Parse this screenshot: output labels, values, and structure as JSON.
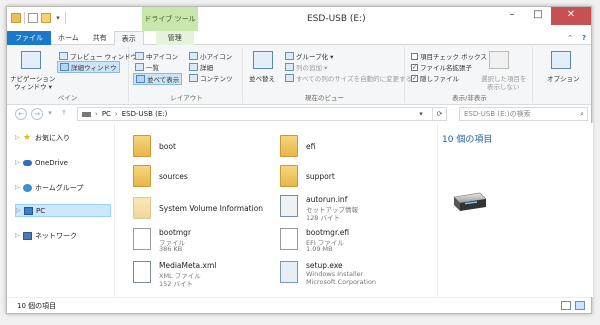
{
  "window": {
    "title": "ESD-USB (E:)",
    "context_tab_title": "ドライブ ツール",
    "controls": {
      "minimize": "–",
      "maximize": "□",
      "close": "✕"
    }
  },
  "quick_access": {
    "dropdown": "▾"
  },
  "tabs": [
    {
      "label": "ファイル"
    },
    {
      "label": "ホーム"
    },
    {
      "label": "共有"
    },
    {
      "label": "表示"
    },
    {
      "label": "管理"
    }
  ],
  "ribbon_controls": {
    "collapse": "⌃",
    "help": "?"
  },
  "ribbon": {
    "pane": {
      "nav_pane_line1": "ナビゲーション",
      "nav_pane_line2": "ウィンドウ ▾",
      "preview_pane": "プレビュー ウィンドウ",
      "details_pane": "詳細ウィンドウ",
      "group_label": "ペイン"
    },
    "layout": {
      "medium_icons": "中アイコン",
      "small_icons": "小アイコン",
      "list": "一覧",
      "details": "詳細",
      "tiles": "並べて表示",
      "content": "コンテンツ",
      "group_label": "レイアウト"
    },
    "current_view": {
      "sort_by": "並べ替え",
      "group_by": "グループ化 ▾",
      "add_columns": "列の追加 ▾",
      "size_all_columns": "すべての列のサイズを自動的に変更する",
      "group_label": "現在のビュー"
    },
    "show_hide": {
      "item_checkboxes": "項目チェック ボックス",
      "file_extensions": "ファイル名拡張子",
      "hidden_items": "隠しファイル",
      "hide_selected_line1": "選択した項目を",
      "hide_selected_line2": "表示しない",
      "group_label": "表示/非表示",
      "checks": {
        "item_checkboxes": false,
        "file_extensions": true,
        "hidden_items": true
      }
    },
    "options": {
      "label": "オプション"
    }
  },
  "address": {
    "back": "←",
    "forward": "→",
    "recent": "▾",
    "up": "↑",
    "path": [
      "PC",
      "ESD-USB (E:)"
    ],
    "separator": "›",
    "dropdown": "▾",
    "refresh": "⟳",
    "search_placeholder": "ESD-USB (E:)の検索",
    "search_icon": "⌕"
  },
  "nav_pane": [
    {
      "label": "お気に入り",
      "icon": "star-icon"
    },
    {
      "label": "OneDrive",
      "icon": "cloud-icon"
    },
    {
      "label": "ホームグループ",
      "icon": "homegroup-icon"
    },
    {
      "label": "PC",
      "icon": "pc-icon",
      "selected": true
    },
    {
      "label": "ネットワーク",
      "icon": "network-icon"
    }
  ],
  "nav_expander": "▷",
  "files": [
    {
      "name": "boot",
      "type": "folder"
    },
    {
      "name": "efi",
      "type": "folder"
    },
    {
      "name": "sources",
      "type": "folder"
    },
    {
      "name": "support",
      "type": "folder"
    },
    {
      "name": "System Volume Information",
      "type": "folder"
    },
    {
      "name": "autorun.inf",
      "line2": "セットアップ情報",
      "line3": "128 バイト",
      "type": "inf"
    },
    {
      "name": "bootmgr",
      "line2": "ファイル",
      "line3": "386 KB",
      "type": "file"
    },
    {
      "name": "bootmgr.efi",
      "line2": "EFI ファイル",
      "line3": "1.09 MB",
      "type": "file"
    },
    {
      "name": "MediaMeta.xml",
      "line2": "XML ファイル",
      "line3": "152 バイト",
      "type": "xml"
    },
    {
      "name": "setup.exe",
      "line2": "Windows Installer",
      "line3": "Microsoft Corporation",
      "type": "exe"
    }
  ],
  "preview": {
    "item_count": "10 個の項目"
  },
  "status": {
    "item_count": "10 個の項目"
  },
  "colors": {
    "accent": "#1979ca",
    "context_tab": "#c7e7ad",
    "close": "#c75050",
    "selection": "#cce8ff"
  }
}
